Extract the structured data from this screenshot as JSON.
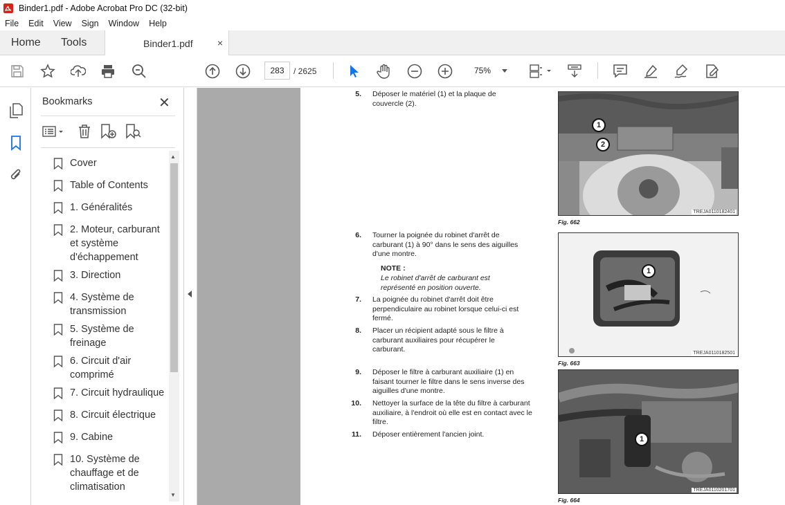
{
  "window": {
    "title": "Binder1.pdf - Adobe Acrobat Pro DC (32-bit)"
  },
  "menu": [
    "File",
    "Edit",
    "View",
    "Sign",
    "Window",
    "Help"
  ],
  "tabs": {
    "home": "Home",
    "tools": "Tools",
    "document": "Binder1.pdf",
    "close": "×"
  },
  "toolbar": {
    "current_page": "283",
    "page_total": "/ 2625",
    "zoom": "75%"
  },
  "bookmarks": {
    "title": "Bookmarks",
    "items": [
      "Cover",
      "Table of Contents",
      "1. Généralités",
      "2. Moteur, carburant et système d'échappement",
      "3. Direction",
      "4. Système de transmission",
      "5. Système de freinage",
      "6. Circuit d'air comprimé",
      "7. Circuit hydraulique",
      "8. Circuit électrique",
      "9. Cabine",
      "10. Système de chauffage et de climatisation"
    ]
  },
  "document": {
    "steps": [
      {
        "num": "5.",
        "text": "Déposer le matériel (1) et la plaque de couvercle (2)."
      },
      {
        "num": "6.",
        "text": "Tourner la poignée du robinet d'arrêt de carburant (1) à 90° dans le sens des aiguilles d'une montre."
      },
      {
        "num": "7.",
        "text": "La poignée du robinet d'arrêt doit être perpendiculaire au robinet lorsque celui-ci est fermé."
      },
      {
        "num": "8.",
        "text": "Placer un récipient adapté sous le filtre à carburant auxiliaires pour récupérer le carburant."
      },
      {
        "num": "9.",
        "text": "Déposer le filtre à carburant auxiliaire (1) en faisant tourner le filtre dans le sens inverse des aiguilles d'une montre."
      },
      {
        "num": "10.",
        "text": "Nettoyer la surface de la tête du filtre à carburant auxiliaire, à l'endroit où elle est en contact avec le filtre."
      },
      {
        "num": "11.",
        "text": "Déposer entièrement l'ancien joint."
      }
    ],
    "note": {
      "label": "NOTE :",
      "text": "Le robinet d'arrêt de carburant est représenté en position ouverte."
    },
    "figures": [
      {
        "caption": "Fig. 662",
        "id": "TREJA0110182401",
        "callouts": [
          "1",
          "2"
        ]
      },
      {
        "caption": "Fig. 663",
        "id": "TREJA0110182501",
        "callouts": [
          "1"
        ]
      },
      {
        "caption": "Fig. 664",
        "id": "TREJA0110201701",
        "callouts": [
          "1"
        ]
      }
    ]
  },
  "colors": {
    "accent": "#d4251c",
    "bookmark_active": "#1473e6",
    "page_gray": "#aaaaaa"
  }
}
